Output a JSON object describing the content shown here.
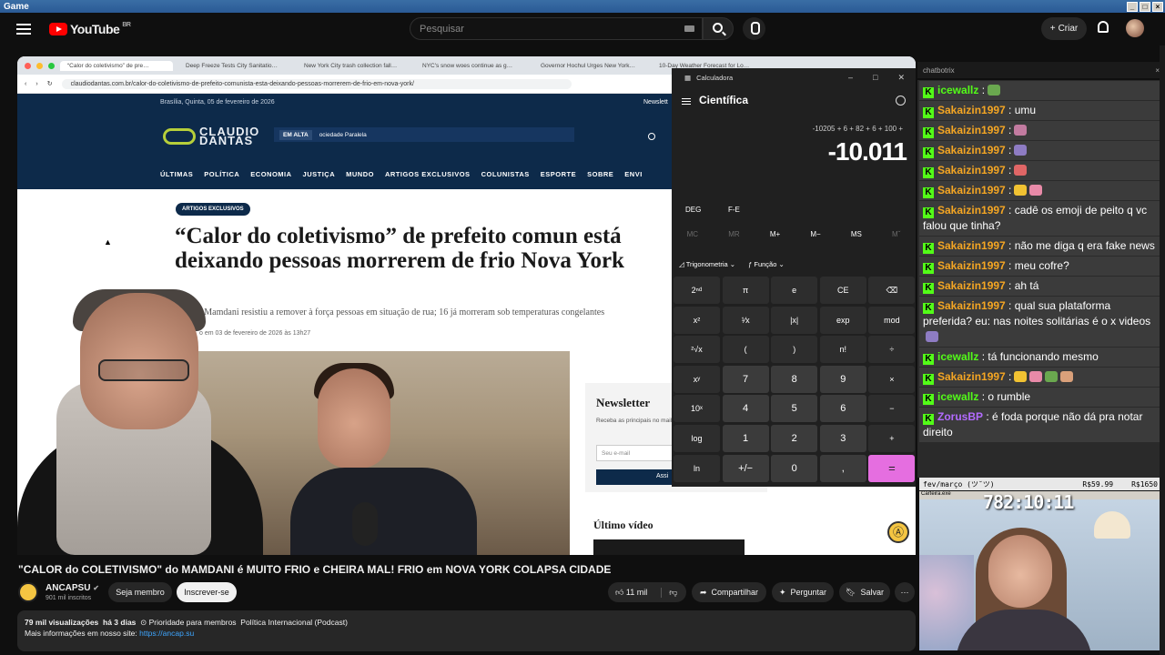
{
  "os": {
    "title": "Game"
  },
  "youtube": {
    "logo": "YouTube",
    "region": "BR",
    "search_placeholder": "Pesquisar",
    "create_label": "Criar"
  },
  "browser": {
    "tabs": [
      "“Calor do coletivismo” de pre…",
      "Deep Freeze Tests City Sanitatio…",
      "New York City trash collection fall…",
      "NYC's snow woes continue as g…",
      "Governor Hochul Urges New York…",
      "10-Day Weather Forecast for Lo…"
    ],
    "url": "claudiodantas.com.br/calor-do-coletivismo-de-prefeito-comunista-esta-deixando-pessoas-morrerem-de-frio-em-nova-york/"
  },
  "site": {
    "date": "Brasília, Quinta, 05 de fevereiro de 2026",
    "newsletter_top": "Newslett",
    "logo_line1": "CLAUDIO",
    "logo_line2": "DANTAS",
    "em_alta": "EM ALTA",
    "em_alta_item": "ociedade Paralela",
    "nav": [
      "ÚLTIMAS",
      "POLÍTICA",
      "ECONOMIA",
      "JUSTIÇA",
      "MUNDO",
      "ARTIGOS EXCLUSIVOS",
      "COLUNISTAS",
      "ESPORTE",
      "SOBRE",
      "ENVI"
    ],
    "badge": "ARTIGOS EXCLUSIVOS",
    "title": "“Calor do coletivismo” de prefeito comun está deixando pessoas morrerem de frio Nova York",
    "subtitle": "ran Mamdani resistiu a remover à força pessoas em situação de rua; 16 já morreram sob temperaturas congelantes",
    "byline": "o em 03 de fevereiro de 2026 às 13h27",
    "newsletter_title": "Newsletter",
    "newsletter_desc": "Receba as principais no mail",
    "newsletter_input": "Seu e-mail",
    "newsletter_btn": "Assi",
    "ultimo_video": "Último vídeo"
  },
  "calculator": {
    "app_title": "Calculadora",
    "mode": "Científica",
    "expression": "-10205 + 6 + 82 + 6 + 100 +",
    "result": "-10.011",
    "deg": "DEG",
    "fe": "F-E",
    "memory": [
      "MC",
      "MR",
      "M+",
      "M−",
      "MS",
      "Mˇ"
    ],
    "trig": "Trigonometria",
    "func": "Função",
    "keys": [
      "2ⁿᵈ",
      "π",
      "e",
      "CE",
      "⌫",
      "x²",
      "¹⁄x",
      "|x|",
      "exp",
      "mod",
      "²√x",
      "(",
      ")",
      "n!",
      "÷",
      "xʸ",
      "7",
      "8",
      "9",
      "×",
      "10ˣ",
      "4",
      "5",
      "6",
      "−",
      "log",
      "1",
      "2",
      "3",
      "+",
      "ln",
      "+/−",
      "0",
      ",",
      "="
    ]
  },
  "chat": {
    "title": "chatbotrix",
    "messages": [
      {
        "user": "icewallz",
        "text": " :",
        "color": "#53fc18"
      },
      {
        "user": "Sakaizin1997",
        "text": " : umu",
        "color": "#f5a623"
      },
      {
        "user": "Sakaizin1997",
        "text": " :",
        "color": "#f5a623"
      },
      {
        "user": "Sakaizin1997",
        "text": " :",
        "color": "#f5a623"
      },
      {
        "user": "Sakaizin1997",
        "text": " :",
        "color": "#f5a623"
      },
      {
        "user": "Sakaizin1997",
        "text": " :",
        "color": "#f5a623"
      },
      {
        "user": "Sakaizin1997",
        "text": " : cadê os emoji de peito q vc falou que tinha?",
        "color": "#f5a623"
      },
      {
        "user": "Sakaizin1997",
        "text": " : não me diga q era fake news",
        "color": "#f5a623"
      },
      {
        "user": "Sakaizin1997",
        "text": " : meu cofre?",
        "color": "#f5a623"
      },
      {
        "user": "Sakaizin1997",
        "text": " : ah tá",
        "color": "#f5a623"
      },
      {
        "user": "Sakaizin1997",
        "text": " : qual sua plataforma preferida? eu: nas noites solitárias é o x videos",
        "color": "#f5a623"
      },
      {
        "user": "icewallz",
        "text": " : tá funcionando mesmo",
        "color": "#53fc18"
      },
      {
        "user": "Sakaizin1997",
        "text": " :",
        "color": "#f5a623"
      },
      {
        "user": "icewallz",
        "text": " : o rumble",
        "color": "#53fc18"
      },
      {
        "user": "ZorusBP",
        "text": " : é foda porque não dá pra notar direito",
        "color": "#b36bff"
      }
    ]
  },
  "goal": {
    "left": "fev/março (ツ˘ツ)",
    "mid": "R$59.99",
    "right": "R$1650"
  },
  "cam": {
    "window": "Carteira.exe",
    "timer": "782:10:11"
  },
  "video": {
    "title": "\"CALOR do COLETIVISMO\" do MAMDANI é MUITO FRIO e CHEIRA MAL! FRIO em NOVA YORK COLAPSA CIDADE",
    "channel": "ANCAPSU",
    "subs": "901 mil inscritos",
    "member_btn": "Seja membro",
    "subscribe_btn": "Inscrever-se",
    "likes": "11 mil",
    "share": "Compartilhar",
    "ask": "Perguntar",
    "save": "Salvar",
    "views": "79 mil visualizações",
    "ago": "há 3 dias",
    "priority": "Prioridade para membros",
    "tag": "Política Internacional (Podcast)",
    "more_info": "Mais informações em nosso site:",
    "link": "https://ancap.su"
  }
}
